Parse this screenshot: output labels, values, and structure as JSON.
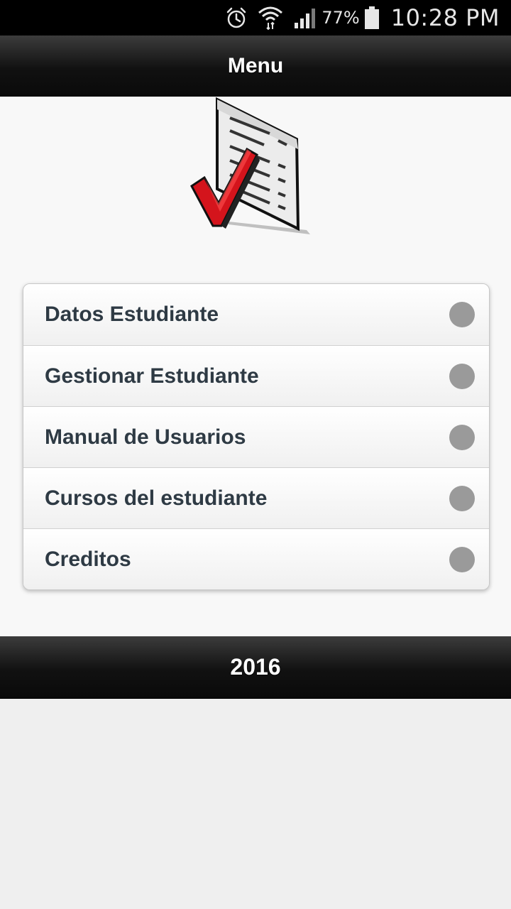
{
  "status_bar": {
    "icons": [
      "alarm-icon",
      "wifi-icon",
      "signal-icon",
      "battery-icon"
    ],
    "battery_percent": "77%",
    "time": "10:28 PM"
  },
  "header": {
    "title": "Menu"
  },
  "logo": {
    "icon": "checklist-logo-icon",
    "colors": {
      "check": "#d4141c"
    }
  },
  "menu": {
    "items": [
      {
        "label": "Datos Estudiante"
      },
      {
        "label": "Gestionar Estudiante"
      },
      {
        "label": "Manual de Usuarios"
      },
      {
        "label": "Cursos del estudiante"
      },
      {
        "label": "Creditos"
      }
    ]
  },
  "footer": {
    "text": "2016"
  }
}
